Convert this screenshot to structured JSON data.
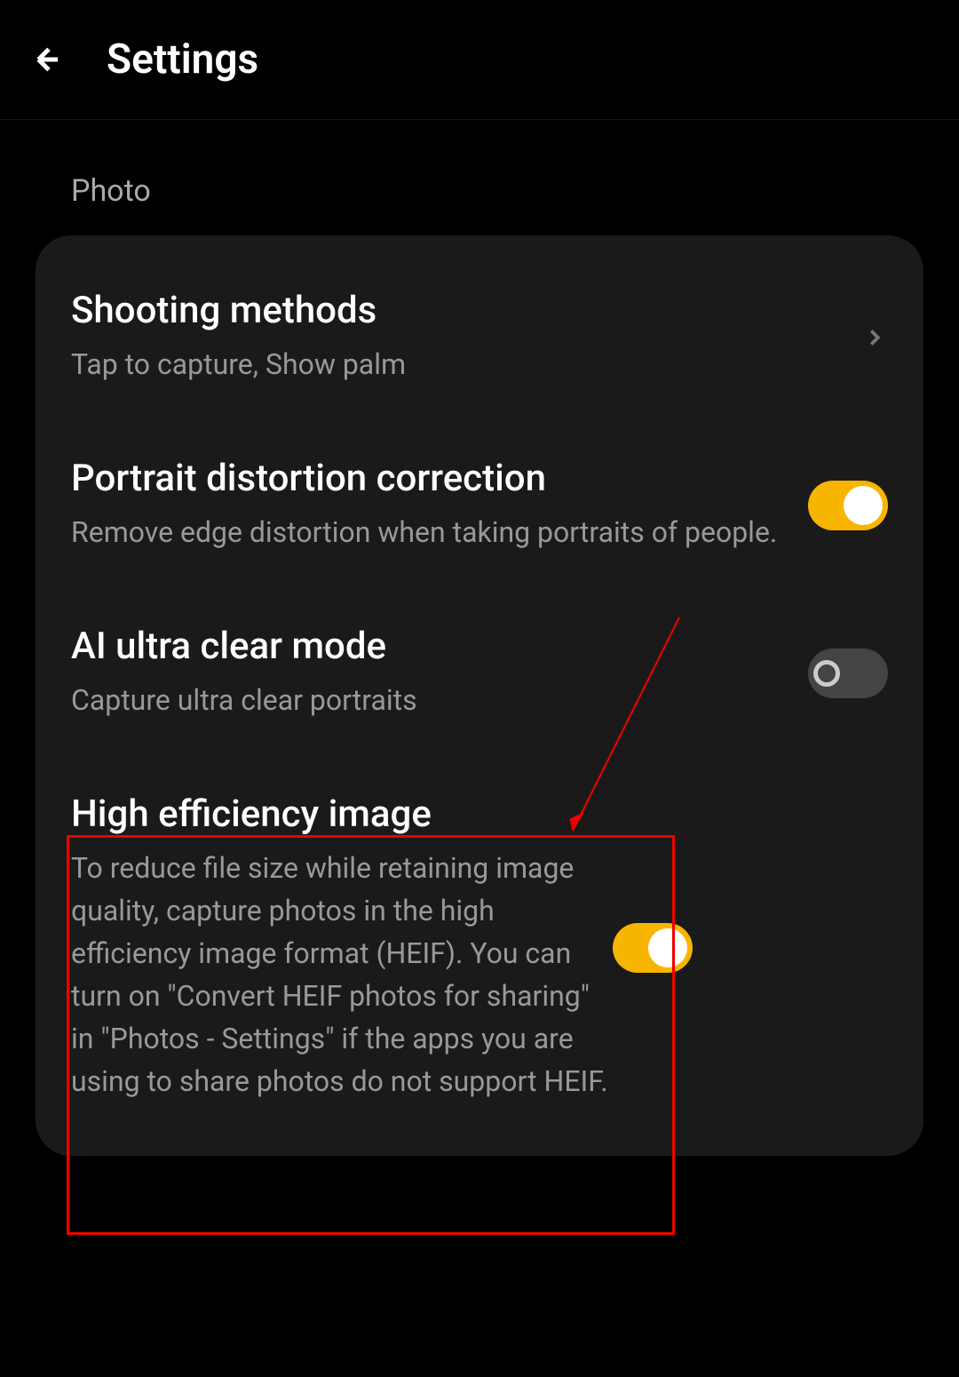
{
  "header": {
    "title": "Settings"
  },
  "section": {
    "label": "Photo"
  },
  "settings": {
    "shooting_methods": {
      "title": "Shooting methods",
      "subtitle": "Tap to capture, Show palm"
    },
    "portrait_distortion": {
      "title": "Portrait distortion correction",
      "subtitle": "Remove edge distortion when taking portraits of people.",
      "enabled": true
    },
    "ai_ultra_clear": {
      "title": "AI ultra clear mode",
      "subtitle": "Capture ultra clear portraits",
      "enabled": false
    },
    "high_efficiency": {
      "title": "High efficiency image",
      "subtitle": "To reduce file size while retaining image quality, capture photos in the high efficiency image format (HEIF). You can turn on \"Convert HEIF photos for sharing\" in \"Photos - Settings\" if the apps you are using to share photos do not support HEIF.",
      "enabled": true
    }
  },
  "annotations": {
    "highlight_color": "#e00"
  }
}
